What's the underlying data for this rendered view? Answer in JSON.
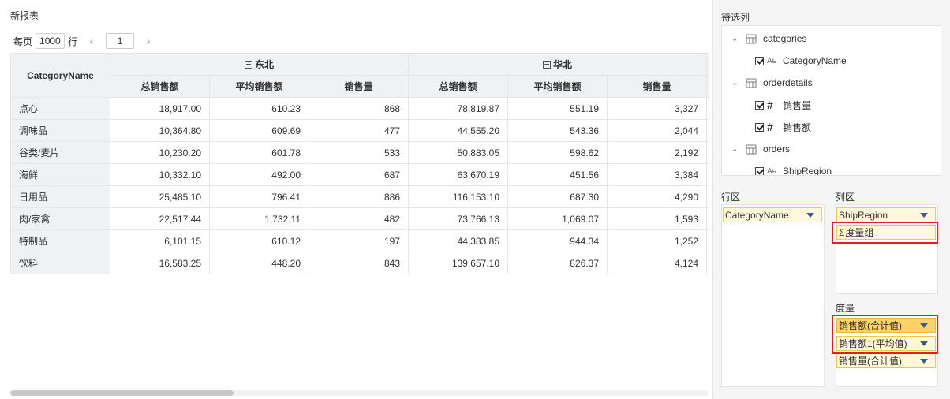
{
  "report": {
    "title": "新报表",
    "pager": {
      "per_page_label": "每页",
      "rows_value": "1000",
      "rows_unit": "行",
      "prev_icon": "‹",
      "page_value": "1",
      "next_icon": "›"
    },
    "table": {
      "row_header": "CategoryName",
      "groups": [
        {
          "name": "东北",
          "collapse_icon": "minus-square-icon"
        },
        {
          "name": "华北",
          "collapse_icon": "minus-square-icon"
        }
      ],
      "measures": [
        "总销售额",
        "平均销售额",
        "销售量",
        "总销售额",
        "平均销售额",
        "销售量"
      ],
      "rows": [
        {
          "name": "点心",
          "cells": [
            "18,917.00",
            "610.23",
            "868",
            "78,819.87",
            "551.19",
            "3,327"
          ]
        },
        {
          "name": "调味品",
          "cells": [
            "10,364.80",
            "609.69",
            "477",
            "44,555.20",
            "543.36",
            "2,044"
          ]
        },
        {
          "name": "谷类/麦片",
          "cells": [
            "10,230.20",
            "601.78",
            "533",
            "50,883.05",
            "598.62",
            "2,192"
          ]
        },
        {
          "name": "海鲜",
          "cells": [
            "10,332.10",
            "492.00",
            "687",
            "63,670.19",
            "451.56",
            "3,384"
          ]
        },
        {
          "name": "日用品",
          "cells": [
            "25,485.10",
            "796.41",
            "886",
            "116,153.10",
            "687.30",
            "4,290"
          ]
        },
        {
          "name": "肉/家禽",
          "cells": [
            "22,517.44",
            "1,732.11",
            "482",
            "73,766.13",
            "1,069.07",
            "1,593"
          ]
        },
        {
          "name": "特制品",
          "cells": [
            "6,101.15",
            "610.12",
            "197",
            "44,383.85",
            "944.34",
            "1,252"
          ]
        },
        {
          "name": "饮料",
          "cells": [
            "16,583.25",
            "448.20",
            "843",
            "139,657.10",
            "826.37",
            "4,124"
          ]
        }
      ]
    }
  },
  "config": {
    "candidates_label": "待选列",
    "tree": [
      {
        "kind": "table",
        "label": "categories",
        "icon": "database-icon"
      },
      {
        "kind": "field",
        "label": "CategoryName",
        "type": "Aь",
        "checked": true
      },
      {
        "kind": "table",
        "label": "orderdetails",
        "icon": "database-icon"
      },
      {
        "kind": "field",
        "label": "销售量",
        "type": "#",
        "checked": true
      },
      {
        "kind": "field",
        "label": "销售额",
        "type": "#",
        "checked": true
      },
      {
        "kind": "table",
        "label": "orders",
        "icon": "database-icon"
      },
      {
        "kind": "field",
        "label": "ShipRegion",
        "type": "Aь",
        "checked": true
      }
    ],
    "row_zone_label": "行区",
    "col_zone_label": "列区",
    "measure_zone_label": "度量",
    "row_pills": [
      "CategoryName"
    ],
    "col_pills": [
      "ShipRegion"
    ],
    "measure_group": {
      "sigma": "Σ",
      "label": "度量组"
    },
    "measure_pills": [
      "销售额(合计值)",
      "销售额1(平均值)",
      "销售量(合计值)"
    ],
    "colors": {
      "pill_border": "#f2c94c",
      "pill_active": "#fcd36a",
      "highlight": "#e02020"
    }
  }
}
